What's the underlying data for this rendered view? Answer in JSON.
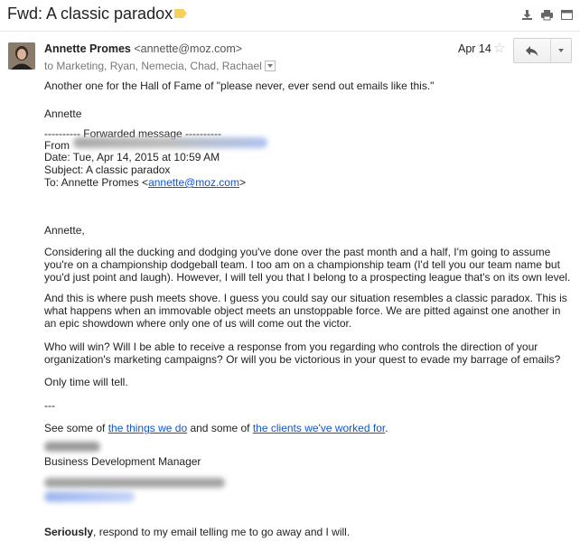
{
  "subject": "Fwd: A classic paradox",
  "colors": {
    "label_tag": "#f6d15a",
    "link": "#1155cc"
  },
  "icons": {
    "print": "print-icon",
    "download": "download-icon",
    "new_window": "new-window-icon",
    "reply": "reply-icon",
    "star": "star-icon"
  },
  "sender": {
    "name": "Annette Promes",
    "email": "<annette@moz.com>",
    "to": "to Marketing, Ryan, Nemecia, Chad, Rachael",
    "date": "Apr 14"
  },
  "body": {
    "intro": "Another one for the Hall of Fame of \"please never, ever send out emails like this.\"",
    "signoff": "Annette",
    "fwd_header": "---------- Forwarded message ----------",
    "from_label": "From",
    "date_line": "Date: Tue, Apr 14, 2015 at 10:59 AM",
    "subject_line": "Subject: A classic paradox",
    "to_prefix": "To: Annette Promes <",
    "to_email": "annette@moz.com",
    "to_suffix": ">",
    "greeting": "Annette,",
    "p1": "Considering all the ducking and dodging you've done over the past month and a half, I'm going to assume you're on a championship dodgeball team. I too am on a championship team (I'd tell you our team name but you'd just point and laugh). However, I will tell you that I belong to a prospecting league that's on its own level.",
    "p2": "And this is where push meets shove. I guess you could say our situation resembles a classic paradox. This is what happens when an immovable object meets an unstoppable force. We are pitted against one another in an epic showdown where only one of us will come out the victor.",
    "p3": "Who will win? Will I be able to receive a response from you regarding who controls the direction of your organization's marketing campaigns? Or will you be victorious in your quest to evade my barrage of emails?",
    "p4": "Only time will tell.",
    "dashes": "---",
    "see_a": "See some of ",
    "link1": "the things we do",
    "see_b": " and some of ",
    "link2": "the clients we've worked for",
    "see_c": ".",
    "title": "Business Development Manager",
    "closing_bold": "Seriously",
    "closing_rest": ", respond to my email telling me to go away and I will."
  }
}
